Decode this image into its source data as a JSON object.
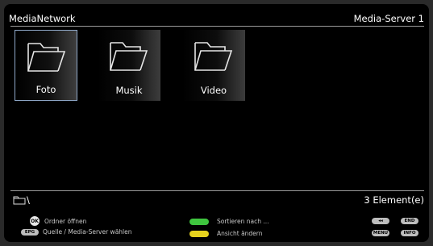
{
  "header": {
    "title": "MediaNetwork",
    "server": "Media-Server 1"
  },
  "folders": [
    {
      "label": "Foto"
    },
    {
      "label": "Musik"
    },
    {
      "label": "Video"
    }
  ],
  "pathbar": {
    "path": "\\",
    "count": "3 Element(e)"
  },
  "help": {
    "ok_badge": "OK",
    "ok_action": "Ordner öffnen",
    "epg_badge": "EPG",
    "epg_action": "Quelle / Media-Server wählen",
    "green_action": "Sortieren nach ...",
    "yellow_action": "Ansicht ändern",
    "rewind_badge": "◂◂",
    "end_badge": "END",
    "menu_badge": "MENU",
    "info_badge": "INFO"
  },
  "colors": {
    "background": "#000000",
    "selection_border": "#8fa8c8",
    "green_key": "#3fc53f",
    "yellow_key": "#e6d21e"
  }
}
